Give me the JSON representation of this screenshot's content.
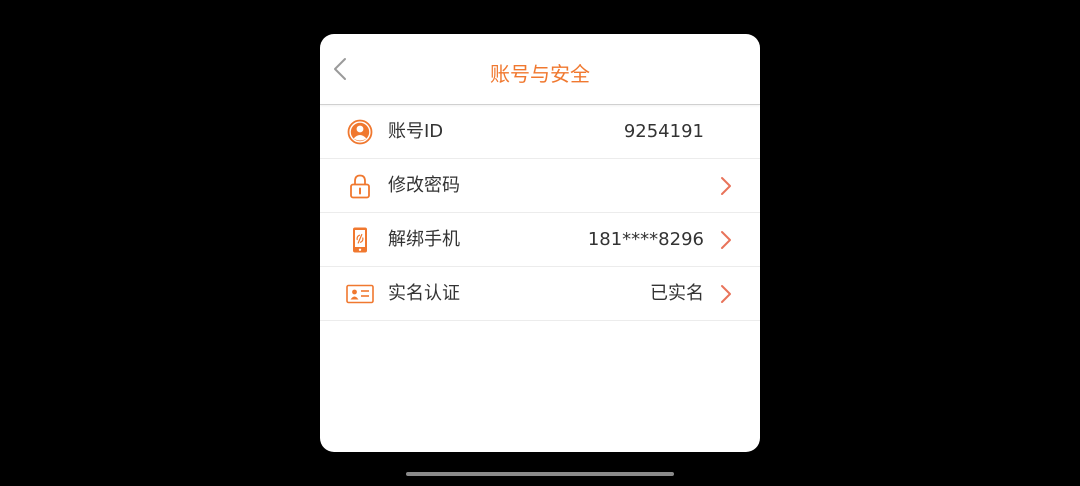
{
  "header": {
    "title": "账号与安全",
    "back_icon": "chevron-left-icon"
  },
  "colors": {
    "accent": "#f0782f",
    "text": "#333333",
    "chevron": "#e8735a"
  },
  "rows": [
    {
      "label": "账号ID",
      "value": "9254191",
      "icon": "user-icon",
      "has_chevron": false
    },
    {
      "label": "修改密码",
      "value": "",
      "icon": "lock-icon",
      "has_chevron": true
    },
    {
      "label": "解绑手机",
      "value": "181****8296",
      "icon": "phone-icon",
      "has_chevron": true
    },
    {
      "label": "实名认证",
      "value": "已实名",
      "icon": "id-card-icon",
      "has_chevron": true
    }
  ]
}
